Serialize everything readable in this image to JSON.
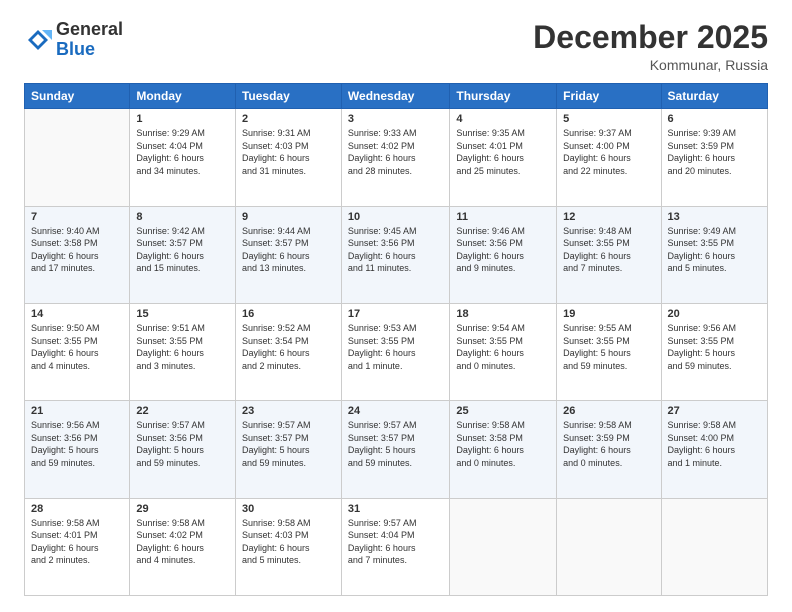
{
  "header": {
    "logo": {
      "general": "General",
      "blue": "Blue"
    },
    "title": "December 2025",
    "subtitle": "Kommunar, Russia"
  },
  "weekdays": [
    "Sunday",
    "Monday",
    "Tuesday",
    "Wednesday",
    "Thursday",
    "Friday",
    "Saturday"
  ],
  "weeks": [
    [
      {
        "num": "",
        "info": ""
      },
      {
        "num": "1",
        "info": "Sunrise: 9:29 AM\nSunset: 4:04 PM\nDaylight: 6 hours\nand 34 minutes."
      },
      {
        "num": "2",
        "info": "Sunrise: 9:31 AM\nSunset: 4:03 PM\nDaylight: 6 hours\nand 31 minutes."
      },
      {
        "num": "3",
        "info": "Sunrise: 9:33 AM\nSunset: 4:02 PM\nDaylight: 6 hours\nand 28 minutes."
      },
      {
        "num": "4",
        "info": "Sunrise: 9:35 AM\nSunset: 4:01 PM\nDaylight: 6 hours\nand 25 minutes."
      },
      {
        "num": "5",
        "info": "Sunrise: 9:37 AM\nSunset: 4:00 PM\nDaylight: 6 hours\nand 22 minutes."
      },
      {
        "num": "6",
        "info": "Sunrise: 9:39 AM\nSunset: 3:59 PM\nDaylight: 6 hours\nand 20 minutes."
      }
    ],
    [
      {
        "num": "7",
        "info": "Sunrise: 9:40 AM\nSunset: 3:58 PM\nDaylight: 6 hours\nand 17 minutes."
      },
      {
        "num": "8",
        "info": "Sunrise: 9:42 AM\nSunset: 3:57 PM\nDaylight: 6 hours\nand 15 minutes."
      },
      {
        "num": "9",
        "info": "Sunrise: 9:44 AM\nSunset: 3:57 PM\nDaylight: 6 hours\nand 13 minutes."
      },
      {
        "num": "10",
        "info": "Sunrise: 9:45 AM\nSunset: 3:56 PM\nDaylight: 6 hours\nand 11 minutes."
      },
      {
        "num": "11",
        "info": "Sunrise: 9:46 AM\nSunset: 3:56 PM\nDaylight: 6 hours\nand 9 minutes."
      },
      {
        "num": "12",
        "info": "Sunrise: 9:48 AM\nSunset: 3:55 PM\nDaylight: 6 hours\nand 7 minutes."
      },
      {
        "num": "13",
        "info": "Sunrise: 9:49 AM\nSunset: 3:55 PM\nDaylight: 6 hours\nand 5 minutes."
      }
    ],
    [
      {
        "num": "14",
        "info": "Sunrise: 9:50 AM\nSunset: 3:55 PM\nDaylight: 6 hours\nand 4 minutes."
      },
      {
        "num": "15",
        "info": "Sunrise: 9:51 AM\nSunset: 3:55 PM\nDaylight: 6 hours\nand 3 minutes."
      },
      {
        "num": "16",
        "info": "Sunrise: 9:52 AM\nSunset: 3:54 PM\nDaylight: 6 hours\nand 2 minutes."
      },
      {
        "num": "17",
        "info": "Sunrise: 9:53 AM\nSunset: 3:55 PM\nDaylight: 6 hours\nand 1 minute."
      },
      {
        "num": "18",
        "info": "Sunrise: 9:54 AM\nSunset: 3:55 PM\nDaylight: 6 hours\nand 0 minutes."
      },
      {
        "num": "19",
        "info": "Sunrise: 9:55 AM\nSunset: 3:55 PM\nDaylight: 5 hours\nand 59 minutes."
      },
      {
        "num": "20",
        "info": "Sunrise: 9:56 AM\nSunset: 3:55 PM\nDaylight: 5 hours\nand 59 minutes."
      }
    ],
    [
      {
        "num": "21",
        "info": "Sunrise: 9:56 AM\nSunset: 3:56 PM\nDaylight: 5 hours\nand 59 minutes."
      },
      {
        "num": "22",
        "info": "Sunrise: 9:57 AM\nSunset: 3:56 PM\nDaylight: 5 hours\nand 59 minutes."
      },
      {
        "num": "23",
        "info": "Sunrise: 9:57 AM\nSunset: 3:57 PM\nDaylight: 5 hours\nand 59 minutes."
      },
      {
        "num": "24",
        "info": "Sunrise: 9:57 AM\nSunset: 3:57 PM\nDaylight: 5 hours\nand 59 minutes."
      },
      {
        "num": "25",
        "info": "Sunrise: 9:58 AM\nSunset: 3:58 PM\nDaylight: 6 hours\nand 0 minutes."
      },
      {
        "num": "26",
        "info": "Sunrise: 9:58 AM\nSunset: 3:59 PM\nDaylight: 6 hours\nand 0 minutes."
      },
      {
        "num": "27",
        "info": "Sunrise: 9:58 AM\nSunset: 4:00 PM\nDaylight: 6 hours\nand 1 minute."
      }
    ],
    [
      {
        "num": "28",
        "info": "Sunrise: 9:58 AM\nSunset: 4:01 PM\nDaylight: 6 hours\nand 2 minutes."
      },
      {
        "num": "29",
        "info": "Sunrise: 9:58 AM\nSunset: 4:02 PM\nDaylight: 6 hours\nand 4 minutes."
      },
      {
        "num": "30",
        "info": "Sunrise: 9:58 AM\nSunset: 4:03 PM\nDaylight: 6 hours\nand 5 minutes."
      },
      {
        "num": "31",
        "info": "Sunrise: 9:57 AM\nSunset: 4:04 PM\nDaylight: 6 hours\nand 7 minutes."
      },
      {
        "num": "",
        "info": ""
      },
      {
        "num": "",
        "info": ""
      },
      {
        "num": "",
        "info": ""
      }
    ]
  ]
}
